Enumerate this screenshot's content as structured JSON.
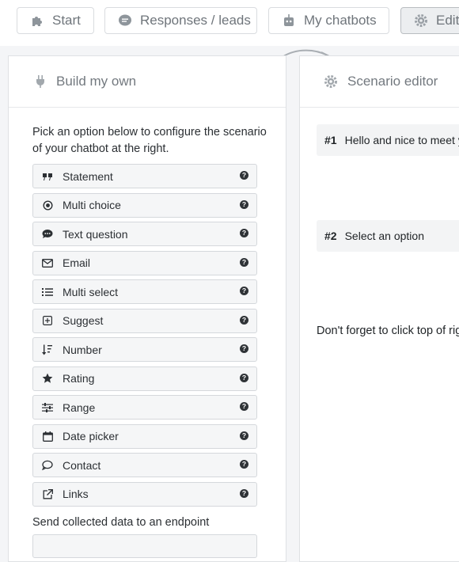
{
  "tabs": [
    {
      "label": "Start",
      "icon": "puzzle-icon"
    },
    {
      "label": "Responses / leads",
      "icon": "chat-bubble-icon"
    },
    {
      "label": "My chatbots",
      "icon": "robot-icon"
    },
    {
      "label": "Edit",
      "icon": "gear-icon",
      "active": true
    }
  ],
  "builder": {
    "title": "Build my own",
    "icon": "plug-icon",
    "intro": "Pick an option below to configure the scenario of your chatbot at the right.",
    "options": [
      {
        "label": "Statement",
        "icon": "quote-icon"
      },
      {
        "label": "Multi choice",
        "icon": "radio-icon"
      },
      {
        "label": "Text question",
        "icon": "comment-dots-icon"
      },
      {
        "label": "Email",
        "icon": "envelope-icon"
      },
      {
        "label": "Multi select",
        "icon": "list-icon"
      },
      {
        "label": "Suggest",
        "icon": "plus-square-icon"
      },
      {
        "label": "Number",
        "icon": "sort-numeric-icon"
      },
      {
        "label": "Rating",
        "icon": "star-icon"
      },
      {
        "label": "Range",
        "icon": "sliders-icon"
      },
      {
        "label": "Date picker",
        "icon": "calendar-icon"
      },
      {
        "label": "Contact",
        "icon": "comment-outline-icon"
      },
      {
        "label": "Links",
        "icon": "external-link-icon"
      }
    ],
    "help_glyph": "?",
    "endpoint_label": "Send collected data to an endpoint"
  },
  "editor": {
    "title": "Scenario editor",
    "icon": "gear-icon",
    "steps": [
      {
        "number": "#1",
        "text": "Hello and nice to meet you"
      },
      {
        "number": "#2",
        "text": "Select an option"
      }
    ],
    "reminder": "Don't forget to click top of right"
  },
  "colors": {
    "accent_text": "#6f757b",
    "panel_border": "#dfe1e4",
    "option_bg": "#f5f6f7"
  }
}
